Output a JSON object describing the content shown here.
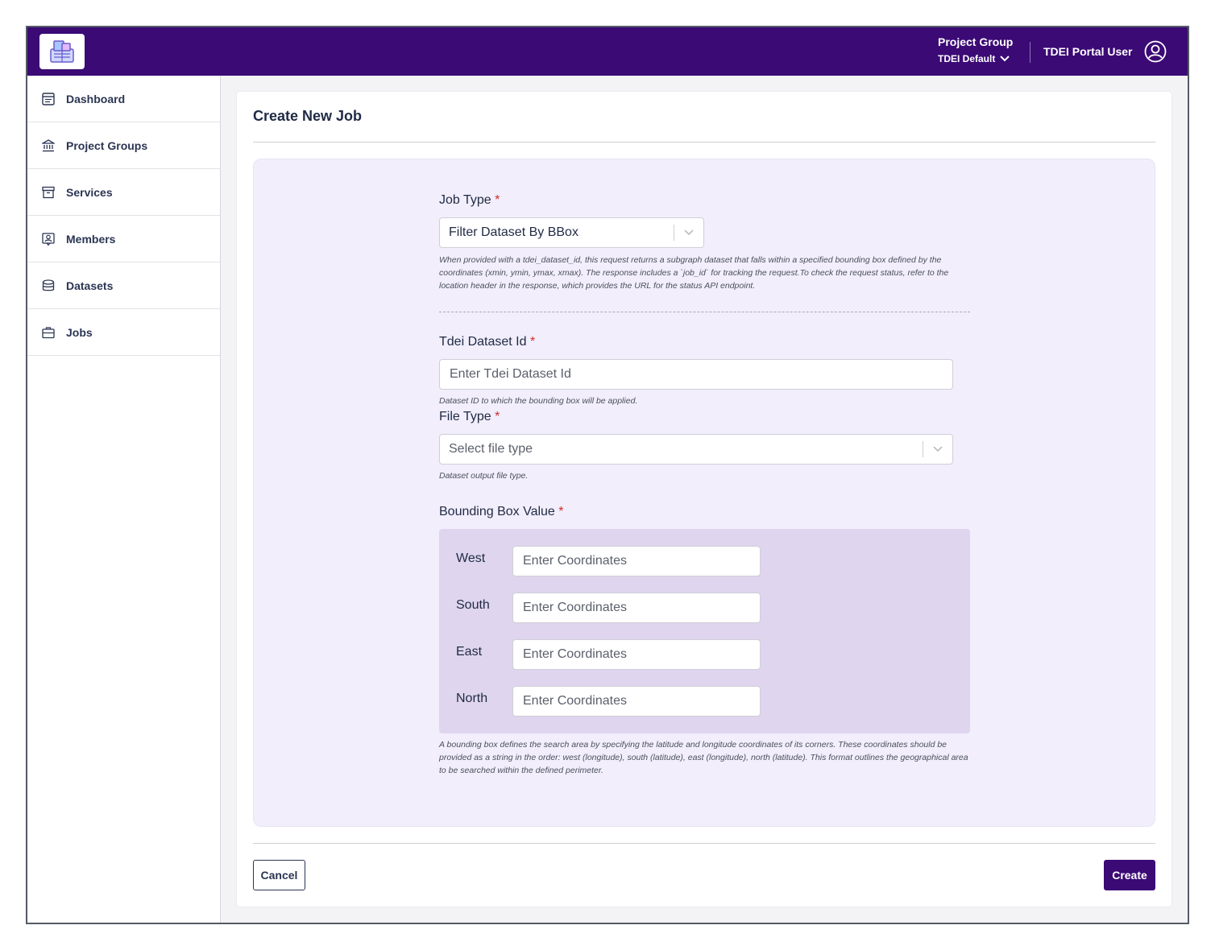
{
  "header": {
    "project_group_label": "Project Group",
    "project_group_value": "TDEI Default",
    "user_name": "TDEI Portal User"
  },
  "sidebar": {
    "items": [
      {
        "label": "Dashboard",
        "icon": "dashboard-icon"
      },
      {
        "label": "Project Groups",
        "icon": "bank-icon"
      },
      {
        "label": "Services",
        "icon": "archive-icon"
      },
      {
        "label": "Members",
        "icon": "member-icon"
      },
      {
        "label": "Datasets",
        "icon": "database-icon"
      },
      {
        "label": "Jobs",
        "icon": "briefcase-icon"
      }
    ]
  },
  "page": {
    "title": "Create New Job"
  },
  "form": {
    "job_type": {
      "label": "Job Type",
      "required_mark": "*",
      "value": "Filter Dataset By BBox",
      "help": "When provided with a tdei_dataset_id, this request returns a subgraph dataset that falls within a specified bounding box defined by the coordinates (xmin, ymin, ymax, xmax). The response includes a `job_id` for tracking the request.To check the request status, refer to the location header in the response, which provides the URL for the status API endpoint."
    },
    "dataset_id": {
      "label": "Tdei Dataset Id",
      "required_mark": "*",
      "placeholder": "Enter Tdei Dataset Id",
      "help": "Dataset ID to which the bounding box will be applied."
    },
    "file_type": {
      "label": "File Type",
      "required_mark": "*",
      "placeholder": "Select file type",
      "help": "Dataset output file type."
    },
    "bbox": {
      "label": "Bounding Box Value",
      "required_mark": "*",
      "west_label": "West",
      "south_label": "South",
      "east_label": "East",
      "north_label": "North",
      "placeholder": "Enter Coordinates",
      "help": "A bounding box defines the search area by specifying the latitude and longitude coordinates of its corners. These coordinates should be provided as a string in the order: west (longitude), south (latitude), east (longitude), north (latitude). This format outlines the geographical area to be searched within the defined perimeter."
    }
  },
  "actions": {
    "cancel": "Cancel",
    "create": "Create"
  },
  "colors": {
    "brand": "#3b0a75",
    "form_bg": "#f2eefc",
    "bbox_bg": "#dfd5ee",
    "required": "#d22b2b"
  }
}
